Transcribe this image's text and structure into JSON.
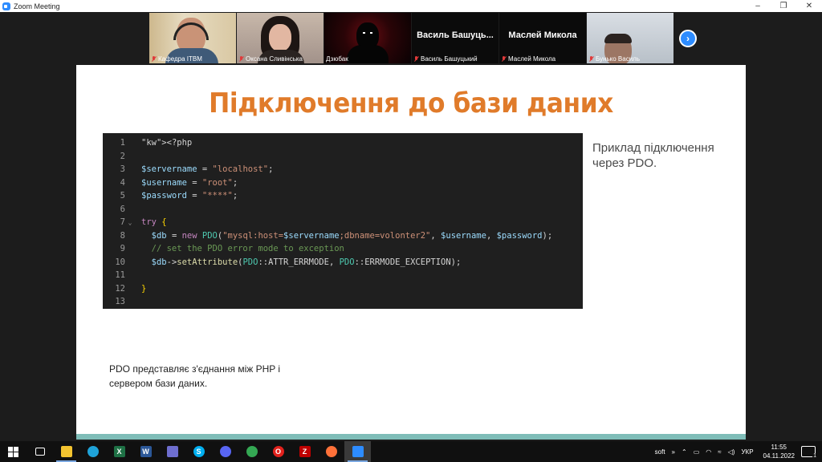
{
  "window": {
    "title": "Zoom Meeting",
    "controls": [
      "–",
      "❐",
      "✕"
    ]
  },
  "participants": [
    {
      "name": "Кафедра ІТВМ",
      "muted": true,
      "video": "photo"
    },
    {
      "name": "Оксана Сливінська",
      "muted": true,
      "video": "photo"
    },
    {
      "name": "Дзюбак",
      "muted": false,
      "video": "photo",
      "active_speaker": true
    },
    {
      "name": "Василь Башуцький",
      "display_name": "Василь  Башуць...",
      "muted": true,
      "video": "off"
    },
    {
      "name": "Маслей Микола",
      "display_name": "Маслей Микола",
      "muted": true,
      "video": "off"
    },
    {
      "name": "Бунько Василь",
      "muted": true,
      "video": "photo"
    }
  ],
  "strip_next_icon": "chevron-right-icon",
  "slide": {
    "title": "Підключення до бази даних",
    "side_note": "Приклад підключення через PDO.",
    "bottom_note": "PDO представляє з'єднання між PHP і сервером бази даних.",
    "accent_color": "#e07b2a",
    "bar_color": "#7fbdb8"
  },
  "code": {
    "language": "php",
    "lines": [
      {
        "n": "1",
        "fold": "",
        "text": "<?php"
      },
      {
        "n": "2",
        "fold": "",
        "text": ""
      },
      {
        "n": "3",
        "fold": "",
        "text": "$servername = \"localhost\";"
      },
      {
        "n": "4",
        "fold": "",
        "text": "$username = \"root\";"
      },
      {
        "n": "5",
        "fold": "",
        "text": "$password = \"****\";"
      },
      {
        "n": "6",
        "fold": "",
        "text": ""
      },
      {
        "n": "7",
        "fold": "⌄",
        "text": "try {"
      },
      {
        "n": "8",
        "fold": "",
        "text": "  $db = new PDO(\"mysql:host=$servername;dbname=volonter2\", $username, $password);"
      },
      {
        "n": "9",
        "fold": "",
        "text": "  // set the PDO error mode to exception"
      },
      {
        "n": "10",
        "fold": "",
        "text": "  $db->setAttribute(PDO::ATTR_ERRMODE, PDO::ERRMODE_EXCEPTION);"
      },
      {
        "n": "11",
        "fold": "",
        "text": ""
      },
      {
        "n": "12",
        "fold": "",
        "text": "}"
      },
      {
        "n": "13",
        "fold": "",
        "text": ""
      }
    ]
  },
  "taskbar": {
    "apps": [
      {
        "name": "start",
        "icon": "windows-icon",
        "color": "#ffffff",
        "label": ""
      },
      {
        "name": "task-view",
        "icon": "task-view-icon",
        "color": "#ffffff",
        "label": ""
      },
      {
        "name": "file-explorer",
        "icon": "folder-icon",
        "color": "#f4c430",
        "label": "",
        "active": true
      },
      {
        "name": "edge",
        "icon": "edge-icon",
        "color": "#1fa3d9",
        "label": ""
      },
      {
        "name": "excel",
        "icon": "excel-icon",
        "color": "#1e7145",
        "label": "X"
      },
      {
        "name": "word",
        "icon": "word-icon",
        "color": "#2b5797",
        "label": "W"
      },
      {
        "name": "store",
        "icon": "store-icon",
        "color": "#6e6ecf",
        "label": ""
      },
      {
        "name": "skype",
        "icon": "skype-icon",
        "color": "#00aff0",
        "label": "S"
      },
      {
        "name": "discord",
        "icon": "discord-icon",
        "color": "#5865f2",
        "label": ""
      },
      {
        "name": "chrome",
        "icon": "chrome-icon",
        "color": "#34a853",
        "label": ""
      },
      {
        "name": "opera",
        "icon": "opera-icon",
        "color": "#e2211c",
        "label": "O"
      },
      {
        "name": "filezilla",
        "icon": "filezilla-icon",
        "color": "#bf0000",
        "label": "Z"
      },
      {
        "name": "firefox",
        "icon": "firefox-icon",
        "color": "#ff7139",
        "label": ""
      },
      {
        "name": "zoom",
        "icon": "zoom-icon",
        "color": "#2d8cff",
        "label": "",
        "active": true
      }
    ],
    "tray": {
      "soft_label": "soft",
      "overflow": "»",
      "language": "УКР",
      "time": "11:55",
      "date": "04.11.2022",
      "notifications": "1"
    }
  }
}
